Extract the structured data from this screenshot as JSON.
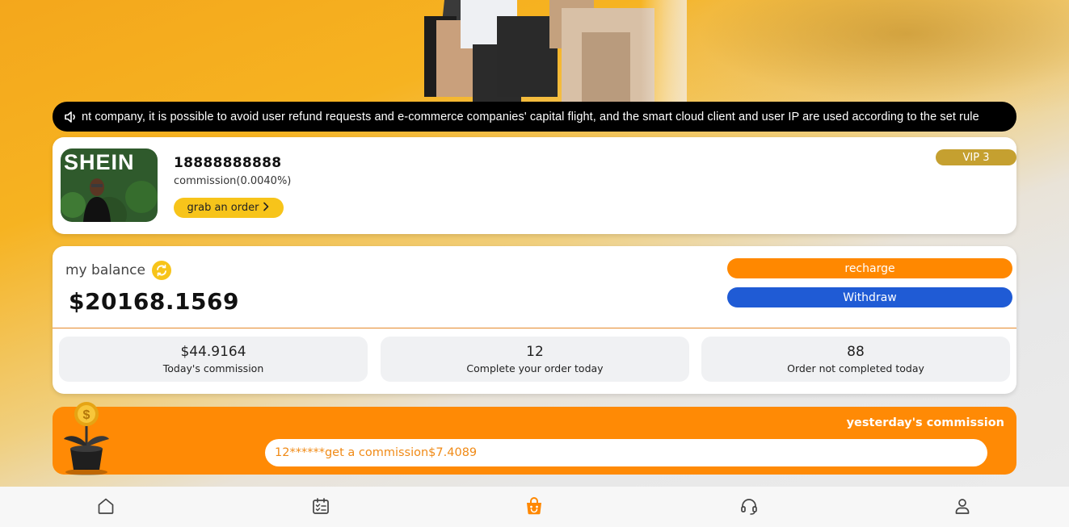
{
  "notice": {
    "icon": "speaker-icon",
    "text": "nt company, it is possible to avoid user refund requests and e-commerce companies' capital flight, and the smart cloud client and user IP are used according to the set rule"
  },
  "profile": {
    "avatar_brand": "SHEIN",
    "phone": "18888888888",
    "commission_rate": "commission(0.0040%)",
    "grab_label": "grab an order",
    "vip_label": "VIP 3"
  },
  "balance": {
    "label": "my balance",
    "amount": "$20168.1569",
    "recharge_label": "recharge",
    "withdraw_label": "Withdraw",
    "stats": [
      {
        "value": "$44.9164",
        "label": "Today's commission"
      },
      {
        "value": "12",
        "label": "Complete your order today"
      },
      {
        "value": "88",
        "label": "Order not completed today"
      }
    ]
  },
  "yesterday": {
    "title": "yesterday's commission",
    "ticker_text": "12******get a commission$7.4089"
  },
  "tabbar": {
    "items": [
      {
        "icon": "home-icon",
        "active": false
      },
      {
        "icon": "calendar-checklist-icon",
        "active": false
      },
      {
        "icon": "shopping-bag-icon",
        "active": true
      },
      {
        "icon": "headset-icon",
        "active": false
      },
      {
        "icon": "user-icon",
        "active": false
      }
    ]
  },
  "colors": {
    "accent_orange": "#ff8800",
    "withdraw_blue": "#1f5bd5",
    "grab_yellow": "#f7c41a",
    "vip_gold": "#c5a030"
  }
}
